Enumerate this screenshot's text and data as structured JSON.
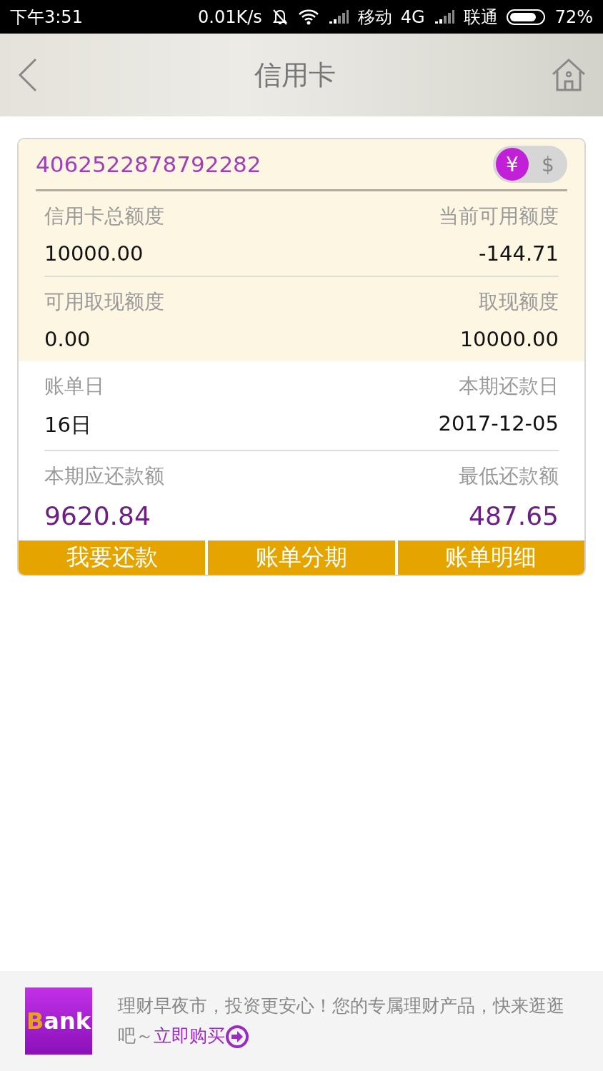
{
  "status_bar": {
    "time": "下午3:51",
    "speed": "0.01K/s",
    "carrier_1": "移动",
    "network": "4G",
    "carrier_2": "联通",
    "battery": "72%"
  },
  "header": {
    "title": "信用卡"
  },
  "card": {
    "number": "4062522878792282",
    "currency": [
      {
        "label": "¥",
        "selected": true
      },
      {
        "label": "$",
        "selected": false
      }
    ],
    "rows": [
      {
        "tinted": true,
        "emphasis": false,
        "left_label": "信用卡总额度",
        "left_value": "10000.00",
        "right_label": "当前可用额度",
        "right_value": "-144.71"
      },
      {
        "tinted": true,
        "emphasis": false,
        "left_label": "可用取现额度",
        "left_value": "0.00",
        "right_label": "取现额度",
        "right_value": "10000.00"
      },
      {
        "tinted": false,
        "emphasis": false,
        "left_label": "账单日",
        "left_value": "16日",
        "right_label": "本期还款日",
        "right_value": "2017-12-05"
      },
      {
        "tinted": false,
        "emphasis": true,
        "left_label": "本期应还款额",
        "left_value": "9620.84",
        "right_label": "最低还款额",
        "right_value": "487.65"
      }
    ],
    "buttons": [
      "我要还款",
      "账单分期",
      "账单明细"
    ]
  },
  "banner": {
    "logo_first": "B",
    "logo_rest": "ank",
    "text": "理财早夜市，投资更安心！您的专属理财产品，快来逛逛吧～",
    "link": "立即购买"
  }
}
